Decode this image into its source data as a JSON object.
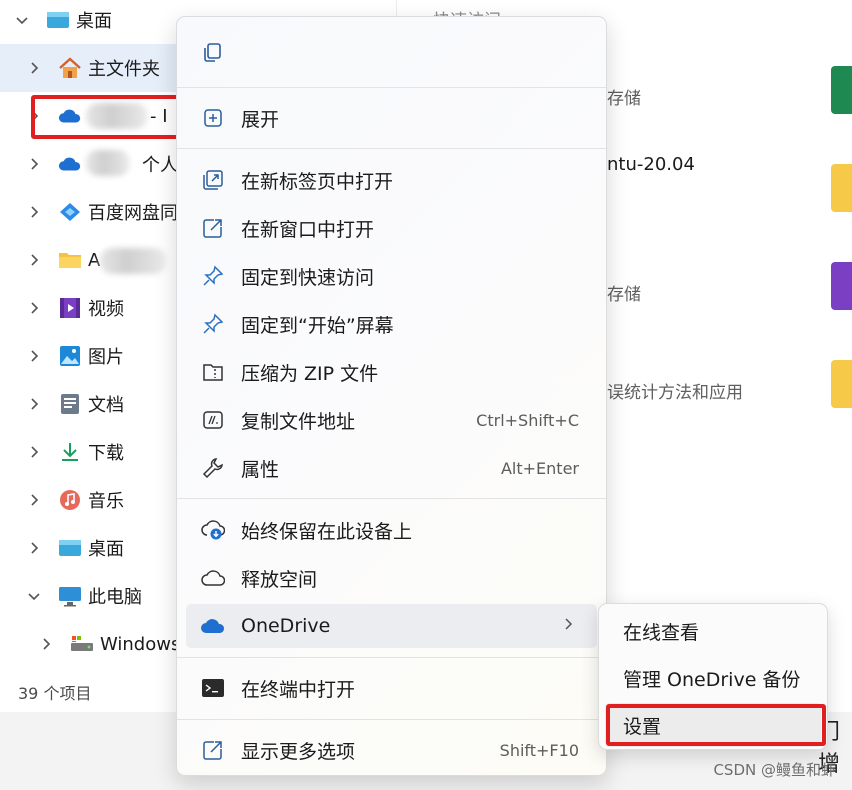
{
  "nav": {
    "items": [
      {
        "label": "桌面",
        "icon": "desktop-icon"
      },
      {
        "label": "主文件夹",
        "icon": "home-icon"
      },
      {
        "label": "- I",
        "icon": "onedrive-cloud-icon"
      },
      {
        "label": "个人",
        "icon": "onedrive-cloud-icon"
      },
      {
        "label": "百度网盘同",
        "icon": "baidu-netdisk-icon"
      },
      {
        "label": "A",
        "icon": "folder-icon"
      },
      {
        "label": "视频",
        "icon": "video-icon"
      },
      {
        "label": "图片",
        "icon": "pictures-icon"
      },
      {
        "label": "文档",
        "icon": "documents-icon"
      },
      {
        "label": "下载",
        "icon": "download-icon"
      },
      {
        "label": "音乐",
        "icon": "music-icon"
      },
      {
        "label": "桌面",
        "icon": "desktop-icon"
      },
      {
        "label": "此电脑",
        "icon": "this-pc-icon"
      },
      {
        "label": "Windows",
        "icon": "drive-icon"
      }
    ]
  },
  "status": {
    "count": "39 个项目"
  },
  "content": {
    "header": "快速访问",
    "row1": "存储",
    "row2": "ntu-20.04",
    "row3": "存储",
    "row4": "误统计方法和应用"
  },
  "context_menu": {
    "copy_icon": "copy-icon",
    "items": [
      {
        "label": "展开",
        "icon": "expand-icon",
        "shortcut": ""
      },
      {
        "label": "在新标签页中打开",
        "icon": "new-tab-icon",
        "shortcut": ""
      },
      {
        "label": "在新窗口中打开",
        "icon": "new-window-icon",
        "shortcut": ""
      },
      {
        "label": "固定到快速访问",
        "icon": "pin-icon",
        "shortcut": ""
      },
      {
        "label": "固定到“开始”屏幕",
        "icon": "pin-start-icon",
        "shortcut": ""
      },
      {
        "label": "压缩为 ZIP 文件",
        "icon": "zip-icon",
        "shortcut": ""
      },
      {
        "label": "复制文件地址",
        "icon": "copy-path-icon",
        "shortcut": "Ctrl+Shift+C"
      },
      {
        "label": "属性",
        "icon": "wrench-icon",
        "shortcut": "Alt+Enter"
      },
      {
        "label": "始终保留在此设备上",
        "icon": "cloud-download-icon",
        "shortcut": ""
      },
      {
        "label": "释放空间",
        "icon": "cloud-outline-icon",
        "shortcut": ""
      },
      {
        "label": "OneDrive",
        "icon": "onedrive-cloud-icon",
        "shortcut": ""
      },
      {
        "label": "在终端中打开",
        "icon": "terminal-icon",
        "shortcut": ""
      },
      {
        "label": "显示更多选项",
        "icon": "show-more-icon",
        "shortcut": "Shift+F10"
      }
    ]
  },
  "submenu": {
    "items": [
      {
        "label": "在线查看"
      },
      {
        "label": "管理 OneDrive 备份"
      },
      {
        "label": "设置"
      }
    ]
  },
  "background_text": "门增",
  "watermark": "CSDN @鳗鱼和虾",
  "colors": {
    "accent": "#0067c0",
    "highlight_box": "#e02020",
    "onedrive_blue": "#2b7cd3"
  }
}
